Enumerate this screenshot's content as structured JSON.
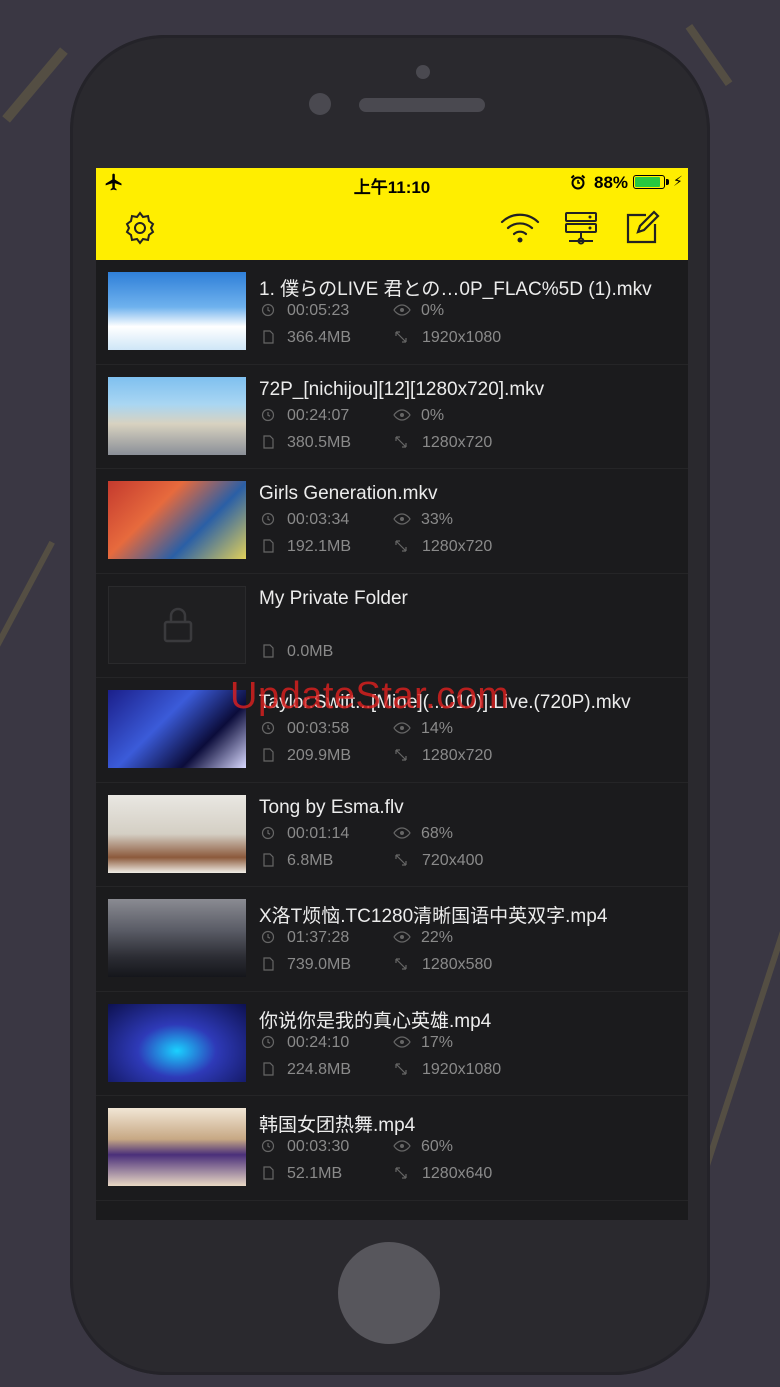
{
  "status_bar": {
    "time": "上午11:10",
    "battery_percent": "88%",
    "battery_level": 0.88,
    "battery_color": "#27c93f"
  },
  "nav_bar": {
    "background": "#ffee00",
    "icons": [
      "gear-icon",
      "wifi-icon",
      "server-icon",
      "edit-icon"
    ]
  },
  "watermark": "UpdateStar.com",
  "files": [
    {
      "title": "1. 僕らのLIVE 君との…0P_FLAC%5D (1).mkv",
      "duration": "00:05:23",
      "progress": "0%",
      "size": "366.4MB",
      "resolution": "1920x1080",
      "thumb": "sky"
    },
    {
      "title": "72P_[nichijou][12][1280x720].mkv",
      "duration": "00:24:07",
      "progress": "0%",
      "size": "380.5MB",
      "resolution": "1280x720",
      "thumb": "street"
    },
    {
      "title": "Girls Generation.mkv",
      "duration": "00:03:34",
      "progress": "33%",
      "size": "192.1MB",
      "resolution": "1280x720",
      "thumb": "dance"
    },
    {
      "title": "My Private Folder",
      "duration": "",
      "progress": "",
      "size": "0.0MB",
      "resolution": "",
      "thumb": "locked"
    },
    {
      "title": "Taylor.Swift...[Mine](...010)].Live.(720P).mkv",
      "duration": "00:03:58",
      "progress": "14%",
      "size": "209.9MB",
      "resolution": "1280x720",
      "thumb": "concert"
    },
    {
      "title": "Tong by Esma.flv",
      "duration": "00:01:14",
      "progress": "68%",
      "size": "6.8MB",
      "resolution": "720x400",
      "thumb": "office"
    },
    {
      "title": "X洛T烦恼.TC1280清晰国语中英双字.mp4",
      "duration": "01:37:28",
      "progress": "22%",
      "size": "739.0MB",
      "resolution": "1280x580",
      "thumb": "city"
    },
    {
      "title": "你说你是我的真心英雄.mp4",
      "duration": "00:24:10",
      "progress": "17%",
      "size": "224.8MB",
      "resolution": "1920x1080",
      "thumb": "stage"
    },
    {
      "title": "韩国女团热舞.mp4",
      "duration": "00:03:30",
      "progress": "60%",
      "size": "52.1MB",
      "resolution": "1280x640",
      "thumb": "studio"
    }
  ]
}
